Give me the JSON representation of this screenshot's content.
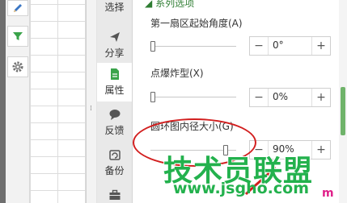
{
  "toolbar": {
    "icons": [
      "pencil-icon",
      "filter-icon",
      "gear-icon"
    ]
  },
  "side_tabs": [
    {
      "label": "选择",
      "icon": "select-icon"
    },
    {
      "label": "分享",
      "icon": "share-icon"
    },
    {
      "label": "属性",
      "icon": "properties-icon",
      "active": true
    },
    {
      "label": "反馈",
      "icon": "feedback-icon"
    },
    {
      "label": "备份",
      "icon": "backup-icon"
    },
    {
      "label": "",
      "icon": "toolbox-icon"
    }
  ],
  "panel": {
    "section_title": "系列选项",
    "options": [
      {
        "label": "第一扇区起始角度(A)",
        "value": "0°",
        "slider_fraction": 0.0
      },
      {
        "label": "点爆炸型(X)",
        "value": "0%",
        "slider_fraction": 0.0
      },
      {
        "label": "圆环图内径大小(G)",
        "value": "90%",
        "slider_fraction": 0.9
      }
    ],
    "minus_label": "−",
    "plus_label": "+"
  },
  "watermark": {
    "main": "技术员联盟",
    "url": "www.jsgho.com",
    "suffix": "m"
  },
  "colors": {
    "accent_green": "#2e7d32",
    "annotation_red": "#d21f1f",
    "watermark_green": "#23b14d",
    "watermark_pink": "#e0208a"
  }
}
